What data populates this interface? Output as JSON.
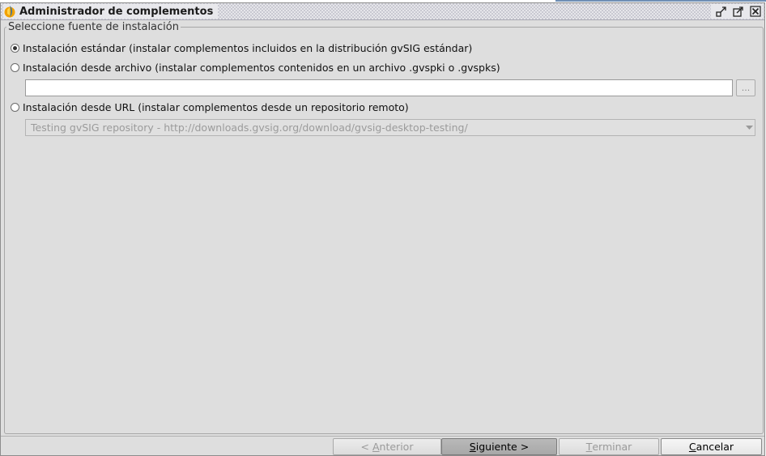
{
  "window": {
    "title": "Administrador de complementos"
  },
  "group": {
    "legend": "Seleccione fuente de instalación"
  },
  "options": [
    {
      "label": "Instalación estándar (instalar complementos incluidos en la distribución gvSIG estándar)",
      "checked": true
    },
    {
      "label": "Instalación desde archivo (instalar complementos contenidos en un archivo .gvspki o .gvspks)",
      "checked": false
    },
    {
      "label": "Instalación desde URL (instalar complementos desde un repositorio remoto)",
      "checked": false
    }
  ],
  "file_input": {
    "value": "",
    "browse_label": "..."
  },
  "url_select": {
    "selected": "Testing gvSIG repository - http://downloads.gvsig.org/download/gvsig-desktop-testing/"
  },
  "buttons": {
    "previous": {
      "prefix": "< ",
      "mnemonic": "A",
      "rest": "nterior",
      "enabled": false
    },
    "next": {
      "prefix": "",
      "mnemonic": "S",
      "rest": "iguiente >",
      "enabled": true
    },
    "finish": {
      "prefix": "",
      "mnemonic": "T",
      "rest": "erminar",
      "enabled": false
    },
    "cancel": {
      "prefix": "",
      "mnemonic": "C",
      "rest": "ancelar",
      "enabled": true
    }
  },
  "icons": {
    "app": "gvsig-icon",
    "minimize": "minimize-icon",
    "maximize": "maximize-icon",
    "close": "close-icon",
    "dropdown": "chevron-down-icon"
  }
}
